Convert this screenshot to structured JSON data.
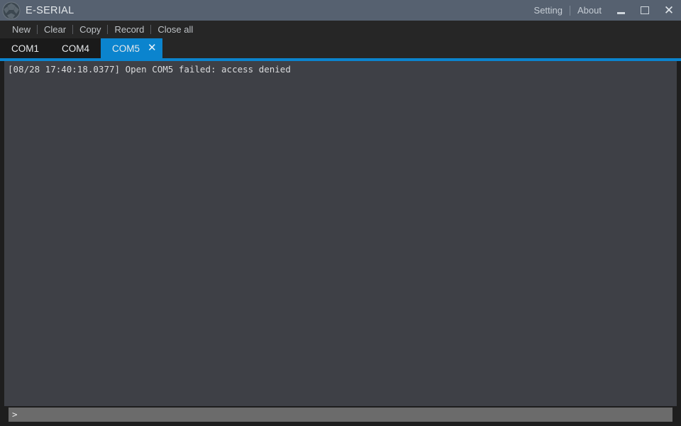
{
  "window": {
    "title": "E-SERIAL",
    "app_icon": "sphere-logo-icon",
    "title_bar_color": "#566170",
    "accent_color": "#0b84ce",
    "console_bg": "#3e4046",
    "menu_bg": "#262626"
  },
  "title_links": [
    {
      "label": "Setting",
      "name": "setting-link"
    },
    {
      "label": "About",
      "name": "about-link"
    }
  ],
  "window_controls": {
    "minimize": "minimize-button",
    "maximize": "maximize-button",
    "close": "close-button",
    "close_glyph": "✕"
  },
  "menu": {
    "items": [
      {
        "label": "New"
      },
      {
        "label": "Clear"
      },
      {
        "label": "Copy"
      },
      {
        "label": "Record"
      },
      {
        "label": "Close all"
      }
    ]
  },
  "tabs": [
    {
      "label": "COM1",
      "active": false
    },
    {
      "label": "COM4",
      "active": false
    },
    {
      "label": "COM5",
      "active": true,
      "close_glyph": "✕"
    }
  ],
  "console": {
    "lines": [
      "[08/28 17:40:18.0377] Open COM5 failed: access denied"
    ]
  },
  "input_bar": {
    "prompt": ">",
    "value": "",
    "placeholder": ""
  }
}
